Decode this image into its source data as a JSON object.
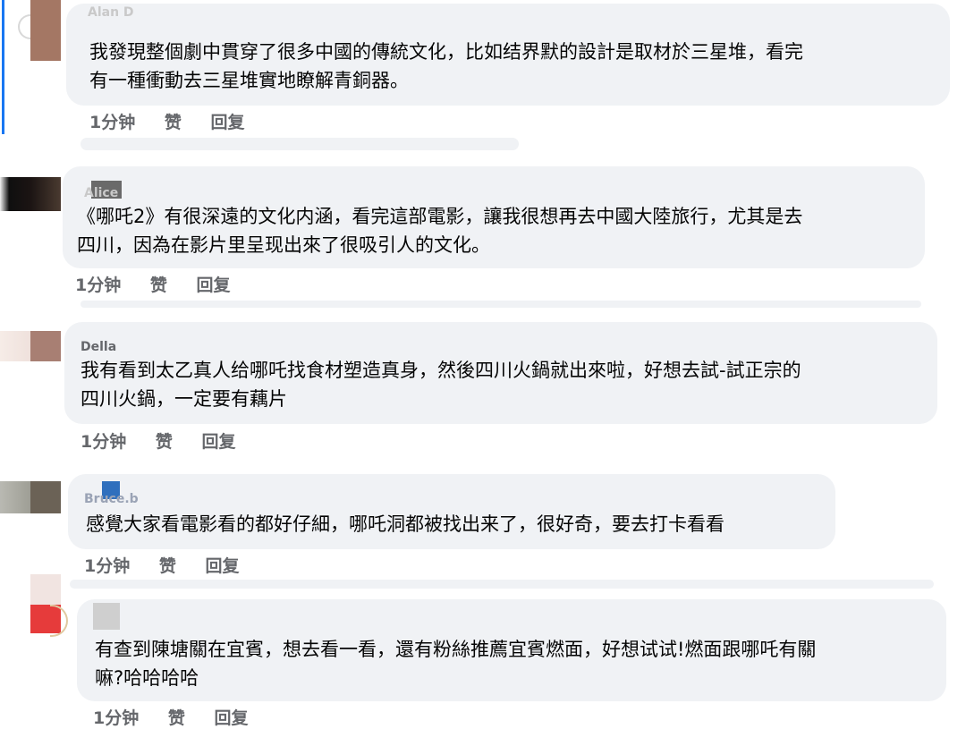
{
  "comments": [
    {
      "author": "Alan D",
      "text_lines": [
        "我發現整個劇中貫穿了很多中國的傳統文化，比如结界默的設計是取材於三星堆，看完",
        "有一種衝動去三星堆實地瞭解青銅器。"
      ],
      "time": "1分钟",
      "like": "赞",
      "reply": "回复",
      "avatar_colors": [
        "#c89b8a",
        "#8a6a55"
      ]
    },
    {
      "author": "Alice",
      "text_lines": [
        "《哪吒2》有很深遠的文化内涵，看完這部電影，讓我很想再去中國大陸旅行，尤其是去",
        "四川，因為在影片里呈现出來了很吸引人的文化。"
      ],
      "time": "1分钟",
      "like": "赞",
      "reply": "回复",
      "avatar_colors": [
        "#1a1a1a",
        "#3b2a22"
      ]
    },
    {
      "author": "Della",
      "text_lines": [
        "我有看到太乙真人给哪吒找食材塑造真身，然後四川火鍋就出來啦，好想去試-試正宗的",
        "四川火鍋，一定要有藕片"
      ],
      "time": "1分钟",
      "like": "赞",
      "reply": "回复",
      "avatar_colors": [
        "#efe1dc",
        "#a87f73"
      ]
    },
    {
      "author": "Bruce.b",
      "text_lines": [
        "感覺大家看電影看的都好仔細，哪吒洞都被找出来了，很好奇，要去打卡看看"
      ],
      "time": "1分钟",
      "like": "赞",
      "reply": "回复",
      "avatar_colors": [
        "#9e9e95",
        "#6b6256"
      ]
    },
    {
      "author": "",
      "text_lines": [
        "有查到陳塘關在宜賓，想去看一看，還有粉絲推薦宜賓燃面，好想试试!燃面跟哪吒有關",
        "嘛?哈哈哈哈"
      ],
      "time": "1分钟",
      "like": "赞",
      "reply": "回复",
      "avatar_colors": [
        "#e63b3b",
        "#f1e4e1"
      ]
    }
  ],
  "colors": {
    "bubble": "#f0f2f5",
    "meta": "#65676b",
    "text": "#050505",
    "accent": "#1877f2"
  }
}
